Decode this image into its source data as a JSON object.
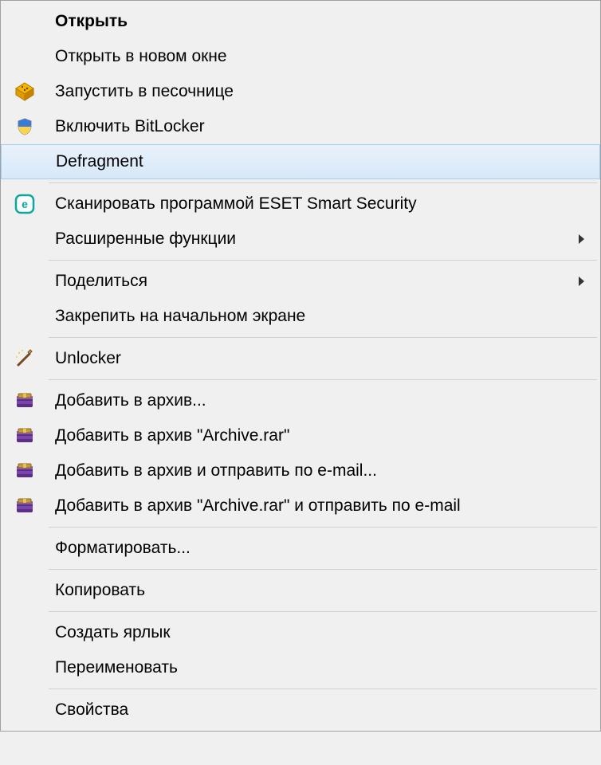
{
  "menu": {
    "items": [
      {
        "label": "Открыть",
        "bold": true,
        "icon": null,
        "submenu": false
      },
      {
        "label": "Открыть в новом окне",
        "bold": false,
        "icon": null,
        "submenu": false
      },
      {
        "label": "Запустить в песочнице",
        "bold": false,
        "icon": "sandbox-icon",
        "submenu": false
      },
      {
        "label": "Включить BitLocker",
        "bold": false,
        "icon": "shield-icon",
        "submenu": false
      },
      {
        "label": "Defragment",
        "bold": false,
        "icon": null,
        "submenu": false,
        "highlighted": true
      },
      {
        "separator": true
      },
      {
        "label": "Сканировать программой ESET Smart Security",
        "bold": false,
        "icon": "eset-icon",
        "submenu": false
      },
      {
        "label": "Расширенные функции",
        "bold": false,
        "icon": null,
        "submenu": true
      },
      {
        "separator": true
      },
      {
        "label": "Поделиться",
        "bold": false,
        "icon": null,
        "submenu": true
      },
      {
        "label": "Закрепить на начальном экране",
        "bold": false,
        "icon": null,
        "submenu": false
      },
      {
        "separator": true
      },
      {
        "label": "Unlocker",
        "bold": false,
        "icon": "wand-icon",
        "submenu": false
      },
      {
        "separator": true
      },
      {
        "label": "Добавить в архив...",
        "bold": false,
        "icon": "winrar-icon",
        "submenu": false
      },
      {
        "label": "Добавить в архив \"Archive.rar\"",
        "bold": false,
        "icon": "winrar-icon",
        "submenu": false
      },
      {
        "label": "Добавить в архив и отправить по e-mail...",
        "bold": false,
        "icon": "winrar-icon",
        "submenu": false
      },
      {
        "label": "Добавить в архив \"Archive.rar\" и отправить по e-mail",
        "bold": false,
        "icon": "winrar-icon",
        "submenu": false
      },
      {
        "separator": true
      },
      {
        "label": "Форматировать...",
        "bold": false,
        "icon": null,
        "submenu": false
      },
      {
        "separator": true
      },
      {
        "label": "Копировать",
        "bold": false,
        "icon": null,
        "submenu": false
      },
      {
        "separator": true
      },
      {
        "label": "Создать ярлык",
        "bold": false,
        "icon": null,
        "submenu": false
      },
      {
        "label": "Переименовать",
        "bold": false,
        "icon": null,
        "submenu": false
      },
      {
        "separator": true
      },
      {
        "label": "Свойства",
        "bold": false,
        "icon": null,
        "submenu": false
      }
    ]
  }
}
